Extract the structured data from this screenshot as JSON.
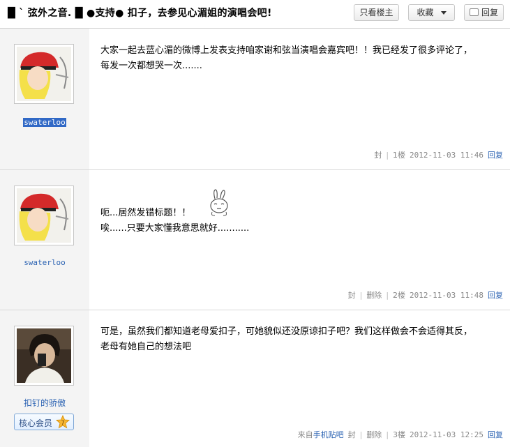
{
  "header": {
    "title": "█ ` 弦外之音. █  ●支持●  扣子，去参见心湄姐的演唱会吧!",
    "btn_louzhu": "只看楼主",
    "btn_collect": "收藏",
    "btn_reply": "回复"
  },
  "posts": [
    {
      "user": "swaterloo",
      "text_lines": [
        "大家一起去蓝心湄的微博上发表支持咱家谢和弦当演唱会嘉宾吧！！我已经发了很多评论了，",
        "每发一次都想哭一次......."
      ],
      "meta": {
        "seal": "封",
        "floor": "1楼",
        "time": "2012-11-03 11:46",
        "reply": "回复"
      }
    },
    {
      "user": "swaterloo",
      "text_lines": [
        "呃...居然发错标题！！",
        "唉......只要大家懂我意思就好..........."
      ],
      "meta": {
        "seal": "封",
        "delete": "删除",
        "floor": "2楼",
        "time": "2012-11-03 11:48",
        "reply": "回复"
      }
    },
    {
      "user": "扣钉的骄傲",
      "badge": "核心会员",
      "badge_level": "7",
      "text_lines": [
        "可是，虽然我们都知道老母爱扣子，可她貌似还没原谅扣子吧？我们这样做会不会适得其反，",
        "老母有她自己的想法吧"
      ],
      "meta": {
        "source_prefix": "来自",
        "source_link": "手机贴吧",
        "seal": "封",
        "delete": "删除",
        "floor": "3楼",
        "time": "2012-11-03 12:25",
        "reply": "回复"
      }
    }
  ]
}
